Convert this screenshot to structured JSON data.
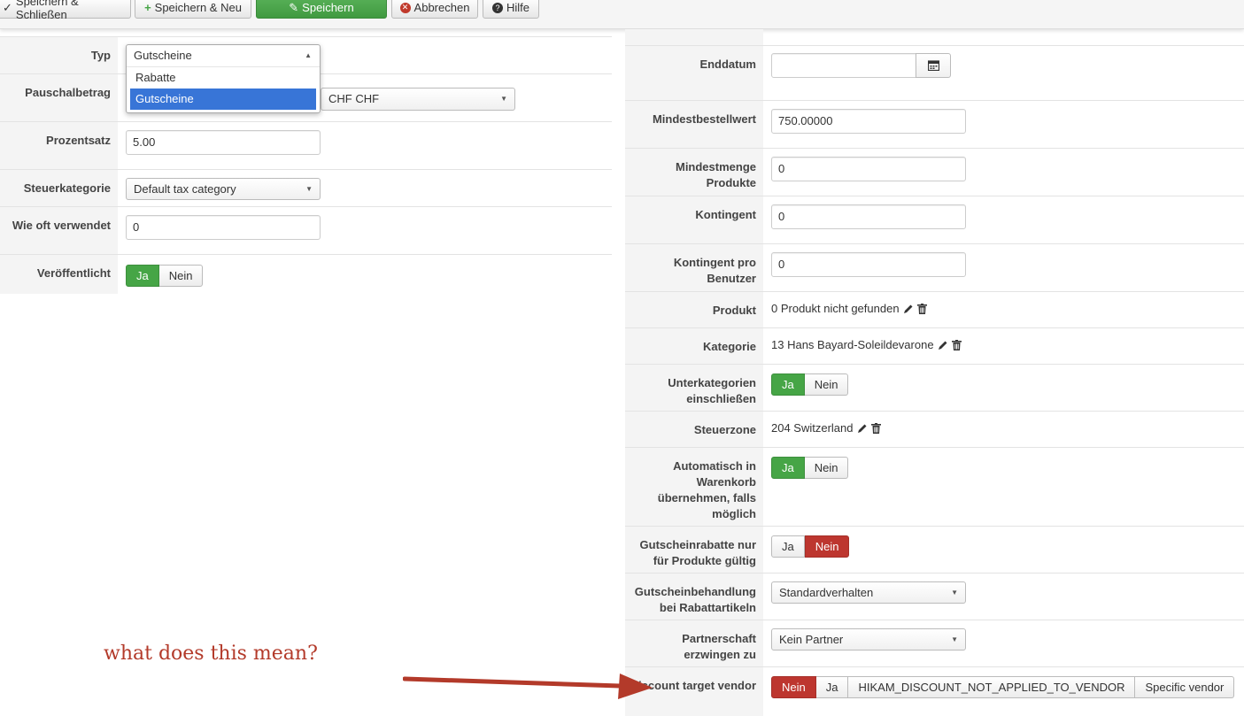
{
  "toolbar": {
    "save_close": "Speichern & Schließen",
    "save_new": "Speichern & Neu",
    "save": "Speichern",
    "cancel": "Abbrechen",
    "help": "Hilfe"
  },
  "left": {
    "typ": {
      "label": "Typ",
      "value": "Gutscheine",
      "options": [
        "Rabatte",
        "Gutscheine"
      ],
      "highlighted": "Gutscheine"
    },
    "pauschal": {
      "label": "Pauschalbetrag",
      "currency": "CHF CHF"
    },
    "prozent": {
      "label": "Prozentsatz",
      "value": "5.00"
    },
    "steuer": {
      "label": "Steuerkategorie",
      "value": "Default tax category"
    },
    "wieoft": {
      "label": "Wie oft verwendet",
      "value": "0"
    },
    "publish": {
      "label": "Veröffentlicht",
      "yes": "Ja",
      "no": "Nein",
      "selected": "Ja"
    }
  },
  "right": {
    "enddatum": {
      "label": "Enddatum",
      "value": ""
    },
    "mindestbestell": {
      "label": "Mindestbestellwert",
      "value": "750.00000"
    },
    "mindestmenge": {
      "label": "Mindestmenge Produkte",
      "value": "0"
    },
    "kontingent": {
      "label": "Kontingent",
      "value": "0"
    },
    "kontingent_pro": {
      "label": "Kontingent pro Benutzer",
      "value": "0"
    },
    "produkt": {
      "label": "Produkt",
      "value": "0 Produkt nicht gefunden"
    },
    "kategorie": {
      "label": "Kategorie",
      "value": "13 Hans Bayard-Soleildevarone"
    },
    "unterkat": {
      "label": "Unterkategorien einschließen",
      "yes": "Ja",
      "no": "Nein",
      "selected": "Ja"
    },
    "steuerzone": {
      "label": "Steuerzone",
      "value": "204 Switzerland"
    },
    "auto": {
      "label": "Automatisch in Warenkorb übernehmen, falls möglich",
      "yes": "Ja",
      "no": "Nein",
      "selected": "Ja"
    },
    "gutscheinrabatte": {
      "label": "Gutscheinrabatte nur für Produkte gültig",
      "yes": "Ja",
      "no": "Nein",
      "selected": "Nein"
    },
    "behandlung": {
      "label": "Gutscheinbehandlung bei Rabattartikeln",
      "value": "Standardverhalten"
    },
    "partner": {
      "label": "Partnerschaft erzwingen zu",
      "value": "Kein Partner"
    },
    "vendor": {
      "label": "Discount target vendor",
      "opt_no": "Nein",
      "opt_yes": "Ja",
      "opt_na": "HIKAM_DISCOUNT_NOT_APPLIED_TO_VENDOR",
      "opt_specific": "Specific vendor",
      "selected": "Nein"
    }
  },
  "annotation": {
    "text": "what does this mean?",
    "color": "#b33a2a"
  },
  "colors": {
    "green": "#46a546",
    "red": "#bd362f",
    "highlight": "#3875d7"
  }
}
